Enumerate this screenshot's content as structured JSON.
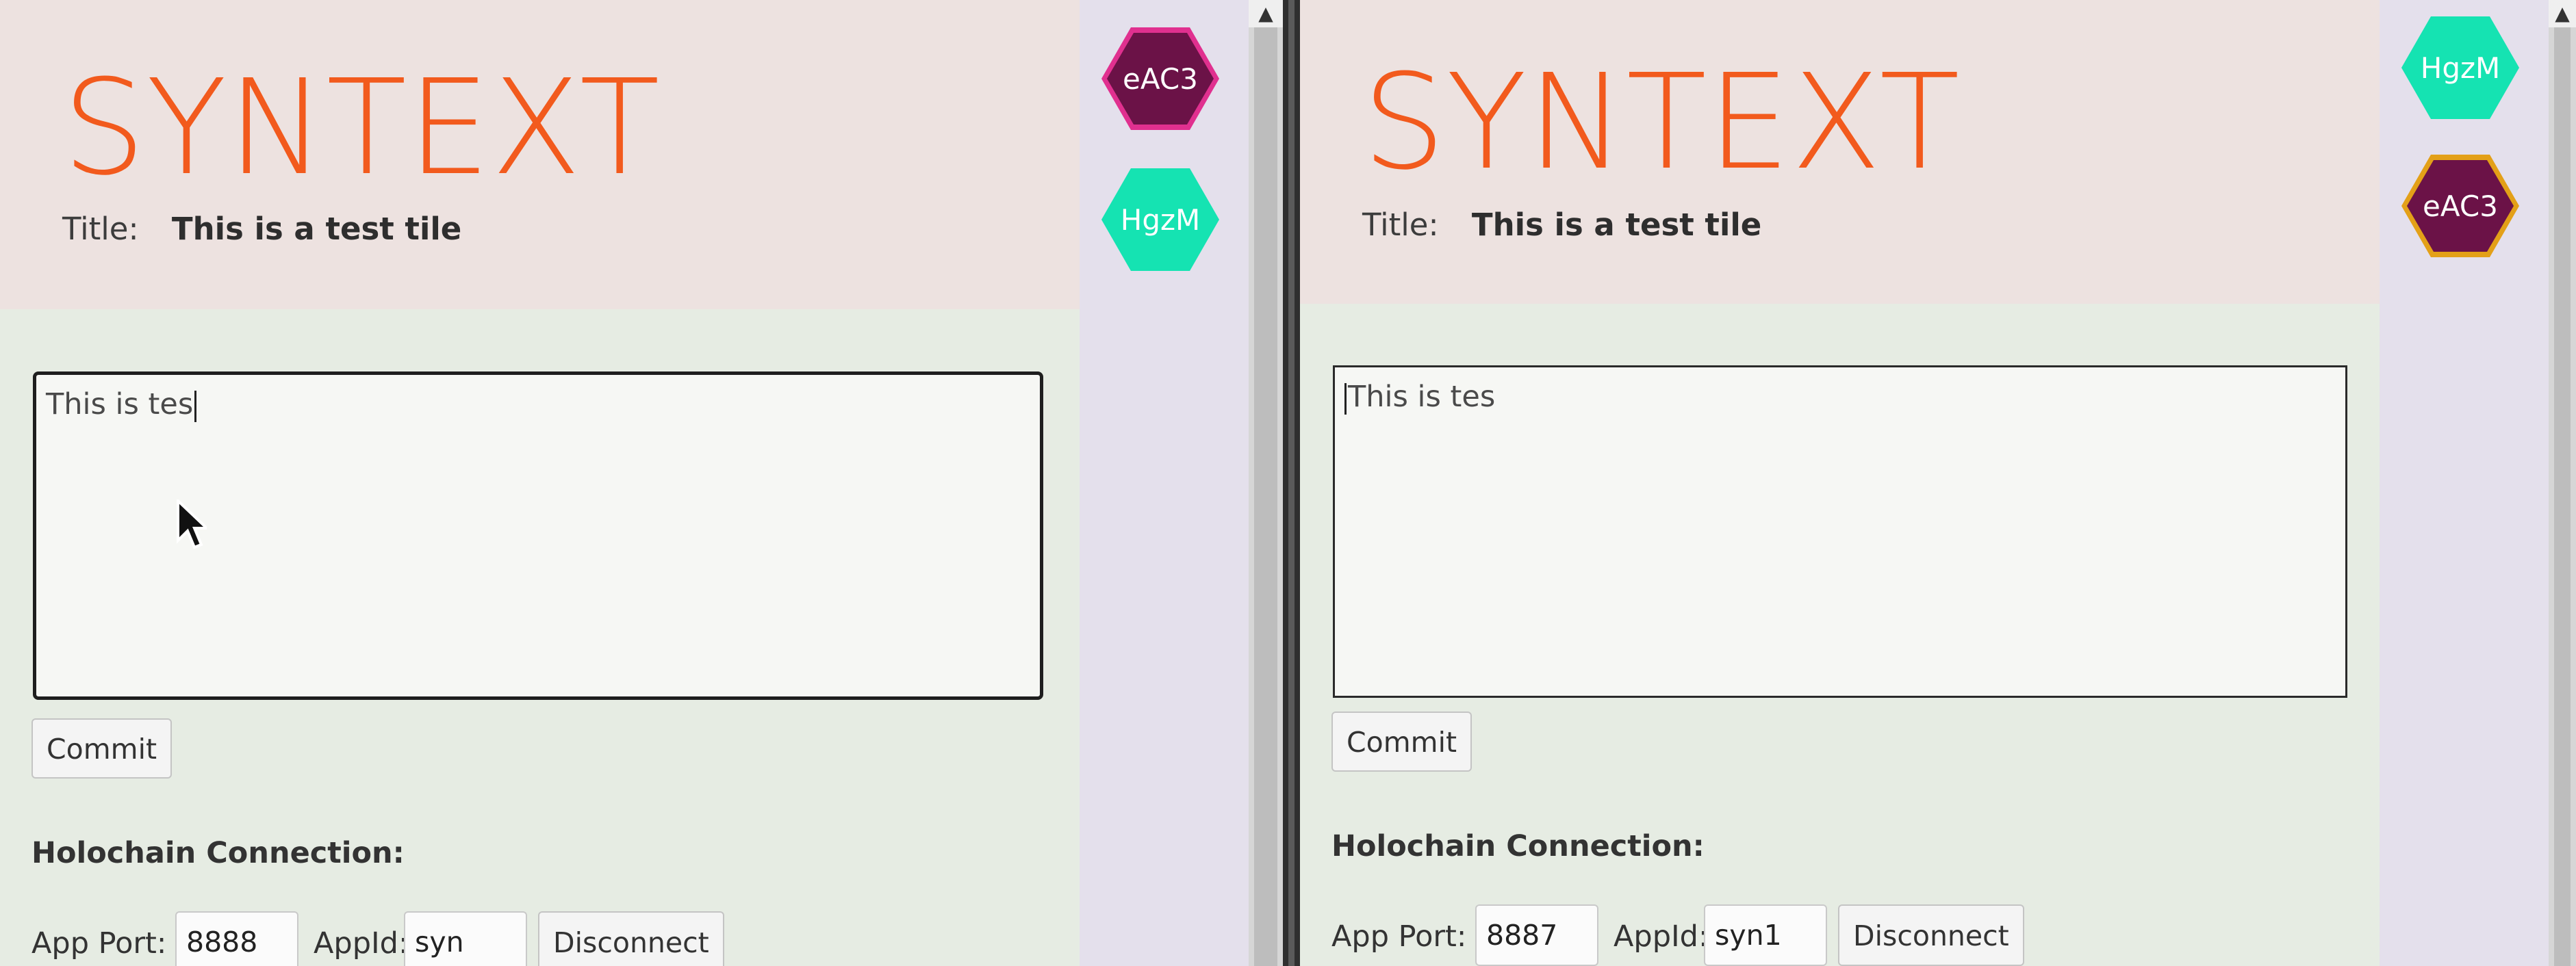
{
  "panes": [
    {
      "logo": "SYNTEXT",
      "title_label": "Title:",
      "title_value": "This is a test tile",
      "editor_text": "This is tes",
      "commit_label": "Commit",
      "connection_heading": "Holochain Connection:",
      "app_port_label": "App Port:",
      "app_port_value": "8888",
      "app_id_label": "AppId:",
      "app_id_value": "syn",
      "disconnect_label": "Disconnect",
      "participants": [
        {
          "label": "eAC3",
          "fill": "#6b1247",
          "border": "#e0308f",
          "text_color": "#ffffff"
        },
        {
          "label": "HgzM",
          "fill": "#15e3b2",
          "border": "#15e3b2",
          "text_color": "#ffffff"
        }
      ]
    },
    {
      "logo": "SYNTEXT",
      "title_label": "Title:",
      "title_value": "This is a test tile",
      "editor_text": "This is tes",
      "commit_label": "Commit",
      "connection_heading": "Holochain Connection:",
      "app_port_label": "App Port:",
      "app_port_value": "8887",
      "app_id_label": "AppId:",
      "app_id_value": "syn1",
      "disconnect_label": "Disconnect",
      "participants": [
        {
          "label": "HgzM",
          "fill": "#15e3b2",
          "border": "#15e3b2",
          "text_color": "#ffffff"
        },
        {
          "label": "eAC3",
          "fill": "#6b1247",
          "border": "#e3a018",
          "text_color": "#ffffff"
        }
      ]
    }
  ],
  "scroll_up_glyph": "▲"
}
